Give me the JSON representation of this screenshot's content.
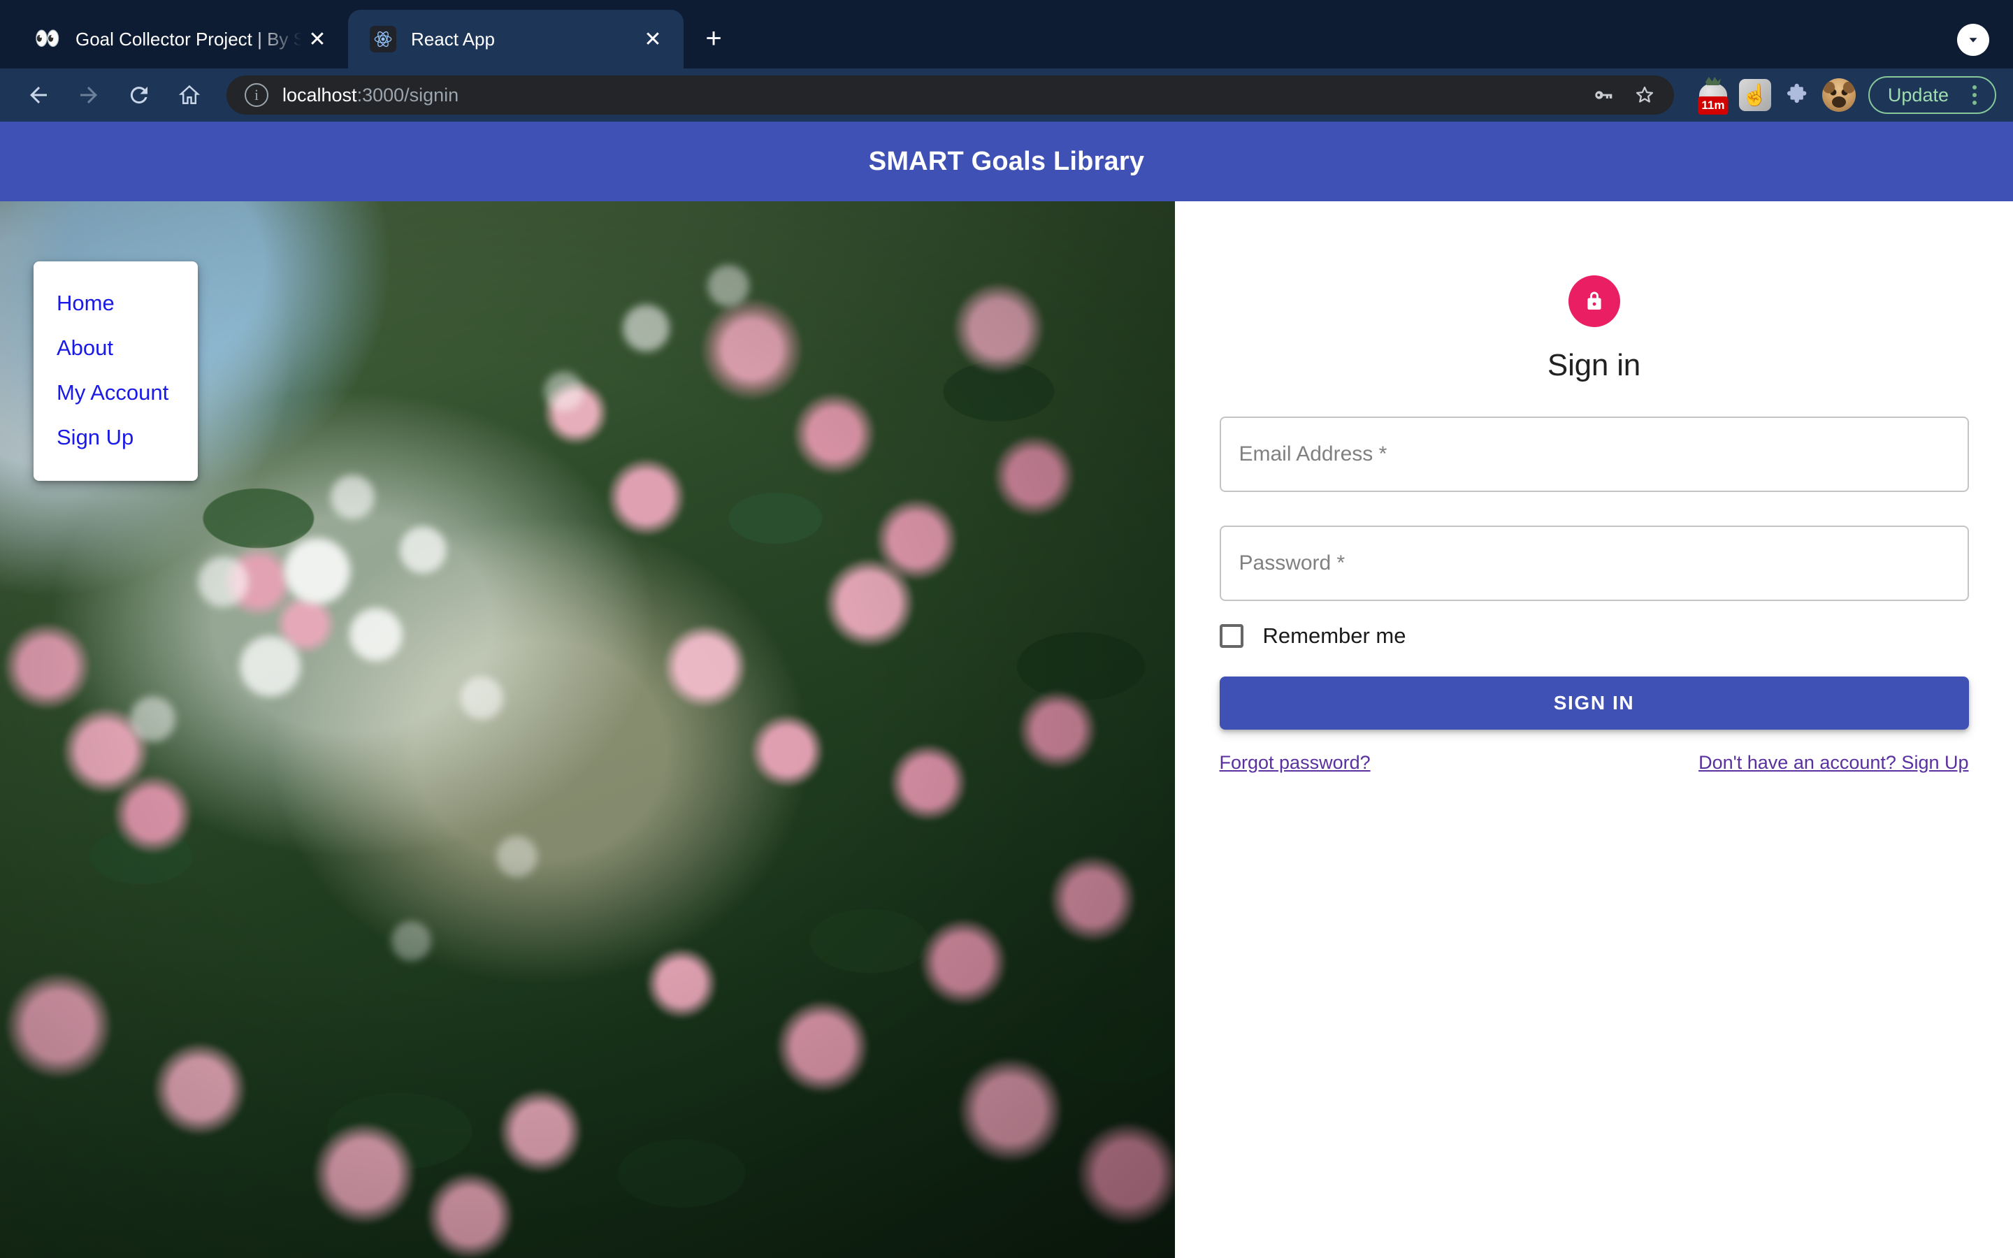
{
  "browser": {
    "tabs": [
      {
        "title": "Goal Collector Project | By Stat",
        "favicon": "eyes-emoji-icon",
        "active": false,
        "close_label": "✕"
      },
      {
        "title": "React App",
        "favicon": "react-logo-icon",
        "active": true,
        "close_label": "✕"
      }
    ],
    "new_tab_label": "+",
    "tab_list_chevron": "chevron-down-icon",
    "nav": {
      "back": "back-arrow-icon",
      "forward": "forward-arrow-icon",
      "reload": "reload-icon",
      "home": "home-icon"
    },
    "omnibox": {
      "info_icon": "info-circle-icon",
      "host": "localhost",
      "path": ":3000/signin",
      "full_url": "localhost:3000/signin",
      "password_key_icon": "key-icon",
      "bookmark_icon": "star-outline-icon"
    },
    "extensions": [
      {
        "name": "tomato-timer-extension",
        "badge": "11m"
      },
      {
        "name": "pointer-extension",
        "glyph": "☝"
      },
      {
        "name": "extensions-puzzle-icon",
        "glyph": "puzzle"
      },
      {
        "name": "profile-avatar",
        "glyph": "dog-avatar"
      }
    ],
    "update_button": "Update",
    "menu_kebab": "kebab-menu-icon"
  },
  "app": {
    "header": {
      "title": "SMART Goals Library"
    },
    "menu": {
      "items": [
        {
          "label": "Home"
        },
        {
          "label": "About"
        },
        {
          "label": "My Account"
        },
        {
          "label": "Sign Up"
        }
      ]
    },
    "hero": {
      "alt": "pink-roses-garden-photo"
    },
    "signin": {
      "lock_icon": "lock-icon",
      "title": "Sign in",
      "email": {
        "placeholder": "Email Address *",
        "value": ""
      },
      "password": {
        "placeholder": "Password *",
        "value": ""
      },
      "remember": {
        "label": "Remember me",
        "checked": false
      },
      "submit_label": "SIGN IN",
      "forgot_link": "Forgot password?",
      "signup_link": "Don't have an account? Sign Up"
    }
  },
  "colors": {
    "primary": "#3f51b5",
    "accent": "#e91e63",
    "link": "#5a30a0",
    "menu_link": "#1a1ae6",
    "browser_chrome": "#1d3557",
    "tabstrip": "#0d1b33"
  }
}
